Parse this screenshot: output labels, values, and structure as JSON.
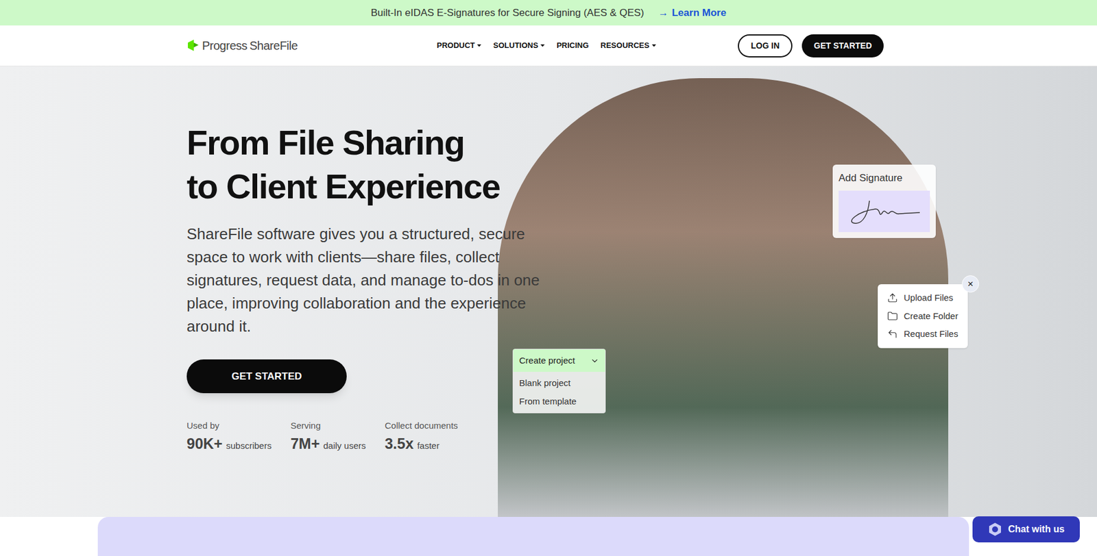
{
  "banner": {
    "text": "Built-In eIDAS E-Signatures for Secure Signing (AES & QES)",
    "arrow": "→",
    "link": "Learn More"
  },
  "logo": {
    "brand": "Progress",
    "product": "ShareFile"
  },
  "nav": [
    {
      "label": "PRODUCT",
      "dropdown": true
    },
    {
      "label": "SOLUTIONS",
      "dropdown": true
    },
    {
      "label": "PRICING",
      "dropdown": false
    },
    {
      "label": "RESOURCES",
      "dropdown": true
    }
  ],
  "auth": {
    "login": "LOG IN",
    "cta": "GET STARTED"
  },
  "hero": {
    "title": [
      "From File Sharing",
      "to Client Experience"
    ],
    "description": "ShareFile software gives you a structured, secure space to work with clients—share files, collect signatures, request data, and manage to-dos in one place, improving collaboration and the experience around it.",
    "cta": "GET STARTED",
    "stats": [
      {
        "label": "Used by",
        "value": "90K+",
        "unit": "subscribers"
      },
      {
        "label": "Serving",
        "value": "7M+",
        "unit": "daily users"
      },
      {
        "label": "Collect documents",
        "value": "3.5x",
        "unit": "faster"
      }
    ]
  },
  "signature_card": {
    "title": "Add Signature"
  },
  "upload_menu": {
    "close": "×",
    "items": [
      "Upload Files",
      "Create Folder",
      "Request Files"
    ]
  },
  "project_dropdown": {
    "label": "Create project",
    "expanded": true,
    "options": [
      "Blank project",
      "From template"
    ]
  },
  "chat": {
    "label": "Chat with us"
  }
}
